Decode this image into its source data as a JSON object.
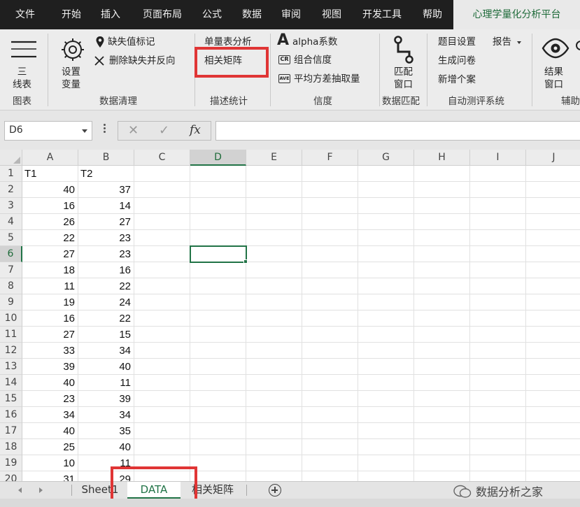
{
  "menu": {
    "tabs": [
      "文件",
      "开始",
      "插入",
      "页面布局",
      "公式",
      "数据",
      "审阅",
      "视图",
      "开发工具",
      "帮助",
      "心理学量化分析平台"
    ],
    "active_index": 10
  },
  "ribbon": {
    "buttons": {
      "three_line": "三\n线表",
      "setup_vars": "设置\n变量",
      "missing_mark": "缺失值标记",
      "delete_reverse": "删除缺失并反向",
      "single_scale": "单量表分析",
      "corr_matrix": "相关矩阵",
      "alpha": "alpha系数",
      "composite": "组合信度",
      "ave": "平均方差抽取量",
      "match_window": "匹配\n窗口",
      "item_setup": "题目设置",
      "report": "报告",
      "gen_questionnaire": "生成问卷",
      "add_case": "新增个案",
      "result_window": "结果\n窗口"
    },
    "badges": {
      "cr": "CR",
      "ave": "AVE",
      "alpha_glyph": "A"
    },
    "groups": [
      "图表",
      "数据清理",
      "描述统计",
      "信度",
      "数据匹配",
      "自动测评系统",
      "辅助"
    ]
  },
  "formula_bar": {
    "name_box": "D6",
    "cancel_symbol": "✕",
    "enter_symbol": "✓",
    "fx_symbol": "fx",
    "formula_value": ""
  },
  "sheet": {
    "columns": [
      "A",
      "B",
      "C",
      "D",
      "E",
      "F",
      "G",
      "H",
      "I",
      "J"
    ],
    "selected_column": "D",
    "rows": [
      "1",
      "2",
      "3",
      "4",
      "5",
      "6",
      "7",
      "8",
      "9",
      "10",
      "11",
      "12",
      "13",
      "14",
      "15",
      "16",
      "17",
      "18",
      "19",
      "20"
    ],
    "selected_row": "6",
    "headers": [
      "T1",
      "T2"
    ],
    "data": [
      [
        40,
        37
      ],
      [
        16,
        14
      ],
      [
        26,
        27
      ],
      [
        22,
        23
      ],
      [
        27,
        23
      ],
      [
        18,
        16
      ],
      [
        11,
        22
      ],
      [
        19,
        24
      ],
      [
        16,
        22
      ],
      [
        27,
        15
      ],
      [
        33,
        34
      ],
      [
        39,
        40
      ],
      [
        40,
        11
      ],
      [
        23,
        39
      ],
      [
        34,
        34
      ],
      [
        40,
        35
      ],
      [
        25,
        40
      ],
      [
        10,
        11
      ],
      [
        31,
        29
      ]
    ]
  },
  "tabs": {
    "sheets": [
      "Sheet1",
      "DATA",
      "相关矩阵"
    ],
    "active": "DATA"
  },
  "watermark": "数据分析之家",
  "colors": {
    "accent": "#217346",
    "highlight": "#e03535",
    "menu_bg": "#1f1f1f",
    "ribbon_bg": "#ececec"
  }
}
